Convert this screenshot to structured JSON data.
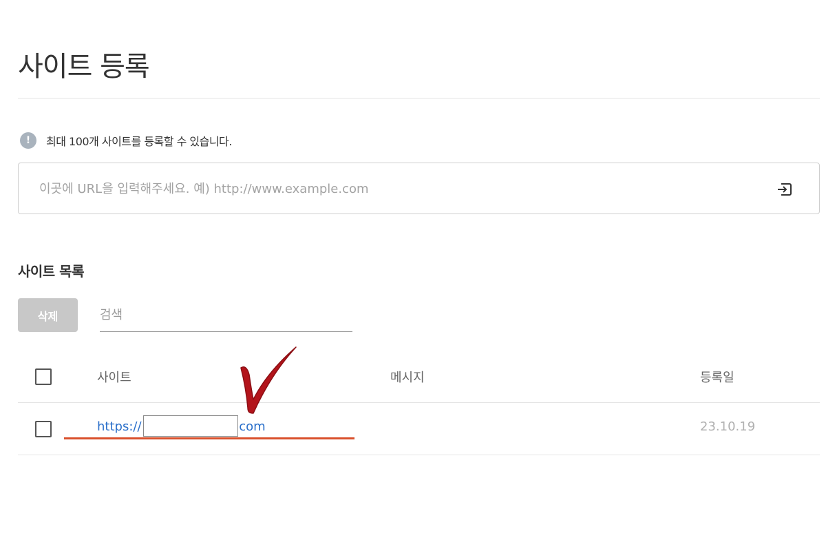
{
  "page": {
    "title": "사이트 등록"
  },
  "notice": {
    "icon": "info-icon",
    "icon_glyph": "!",
    "text": "최대 100개 사이트를 등록할 수 있습니다."
  },
  "url_input": {
    "value": "",
    "placeholder": "이곳에 URL을 입력해주세요. 예) http://www.example.com",
    "submit_icon": "enter-icon"
  },
  "site_list": {
    "section_title": "사이트 목록",
    "delete_label": "삭제",
    "search_placeholder": "검색",
    "columns": {
      "site": "사이트",
      "message": "메시지",
      "date": "등록일"
    },
    "rows": [
      {
        "url_prefix": "https://",
        "url_suffix": ".com",
        "message": "",
        "date": "23.10.19"
      }
    ]
  },
  "colors": {
    "link": "#2a6fca",
    "annotation_red": "#d9502b",
    "check_red": "#b3141b",
    "delete_disabled": "#c8c8c8"
  }
}
